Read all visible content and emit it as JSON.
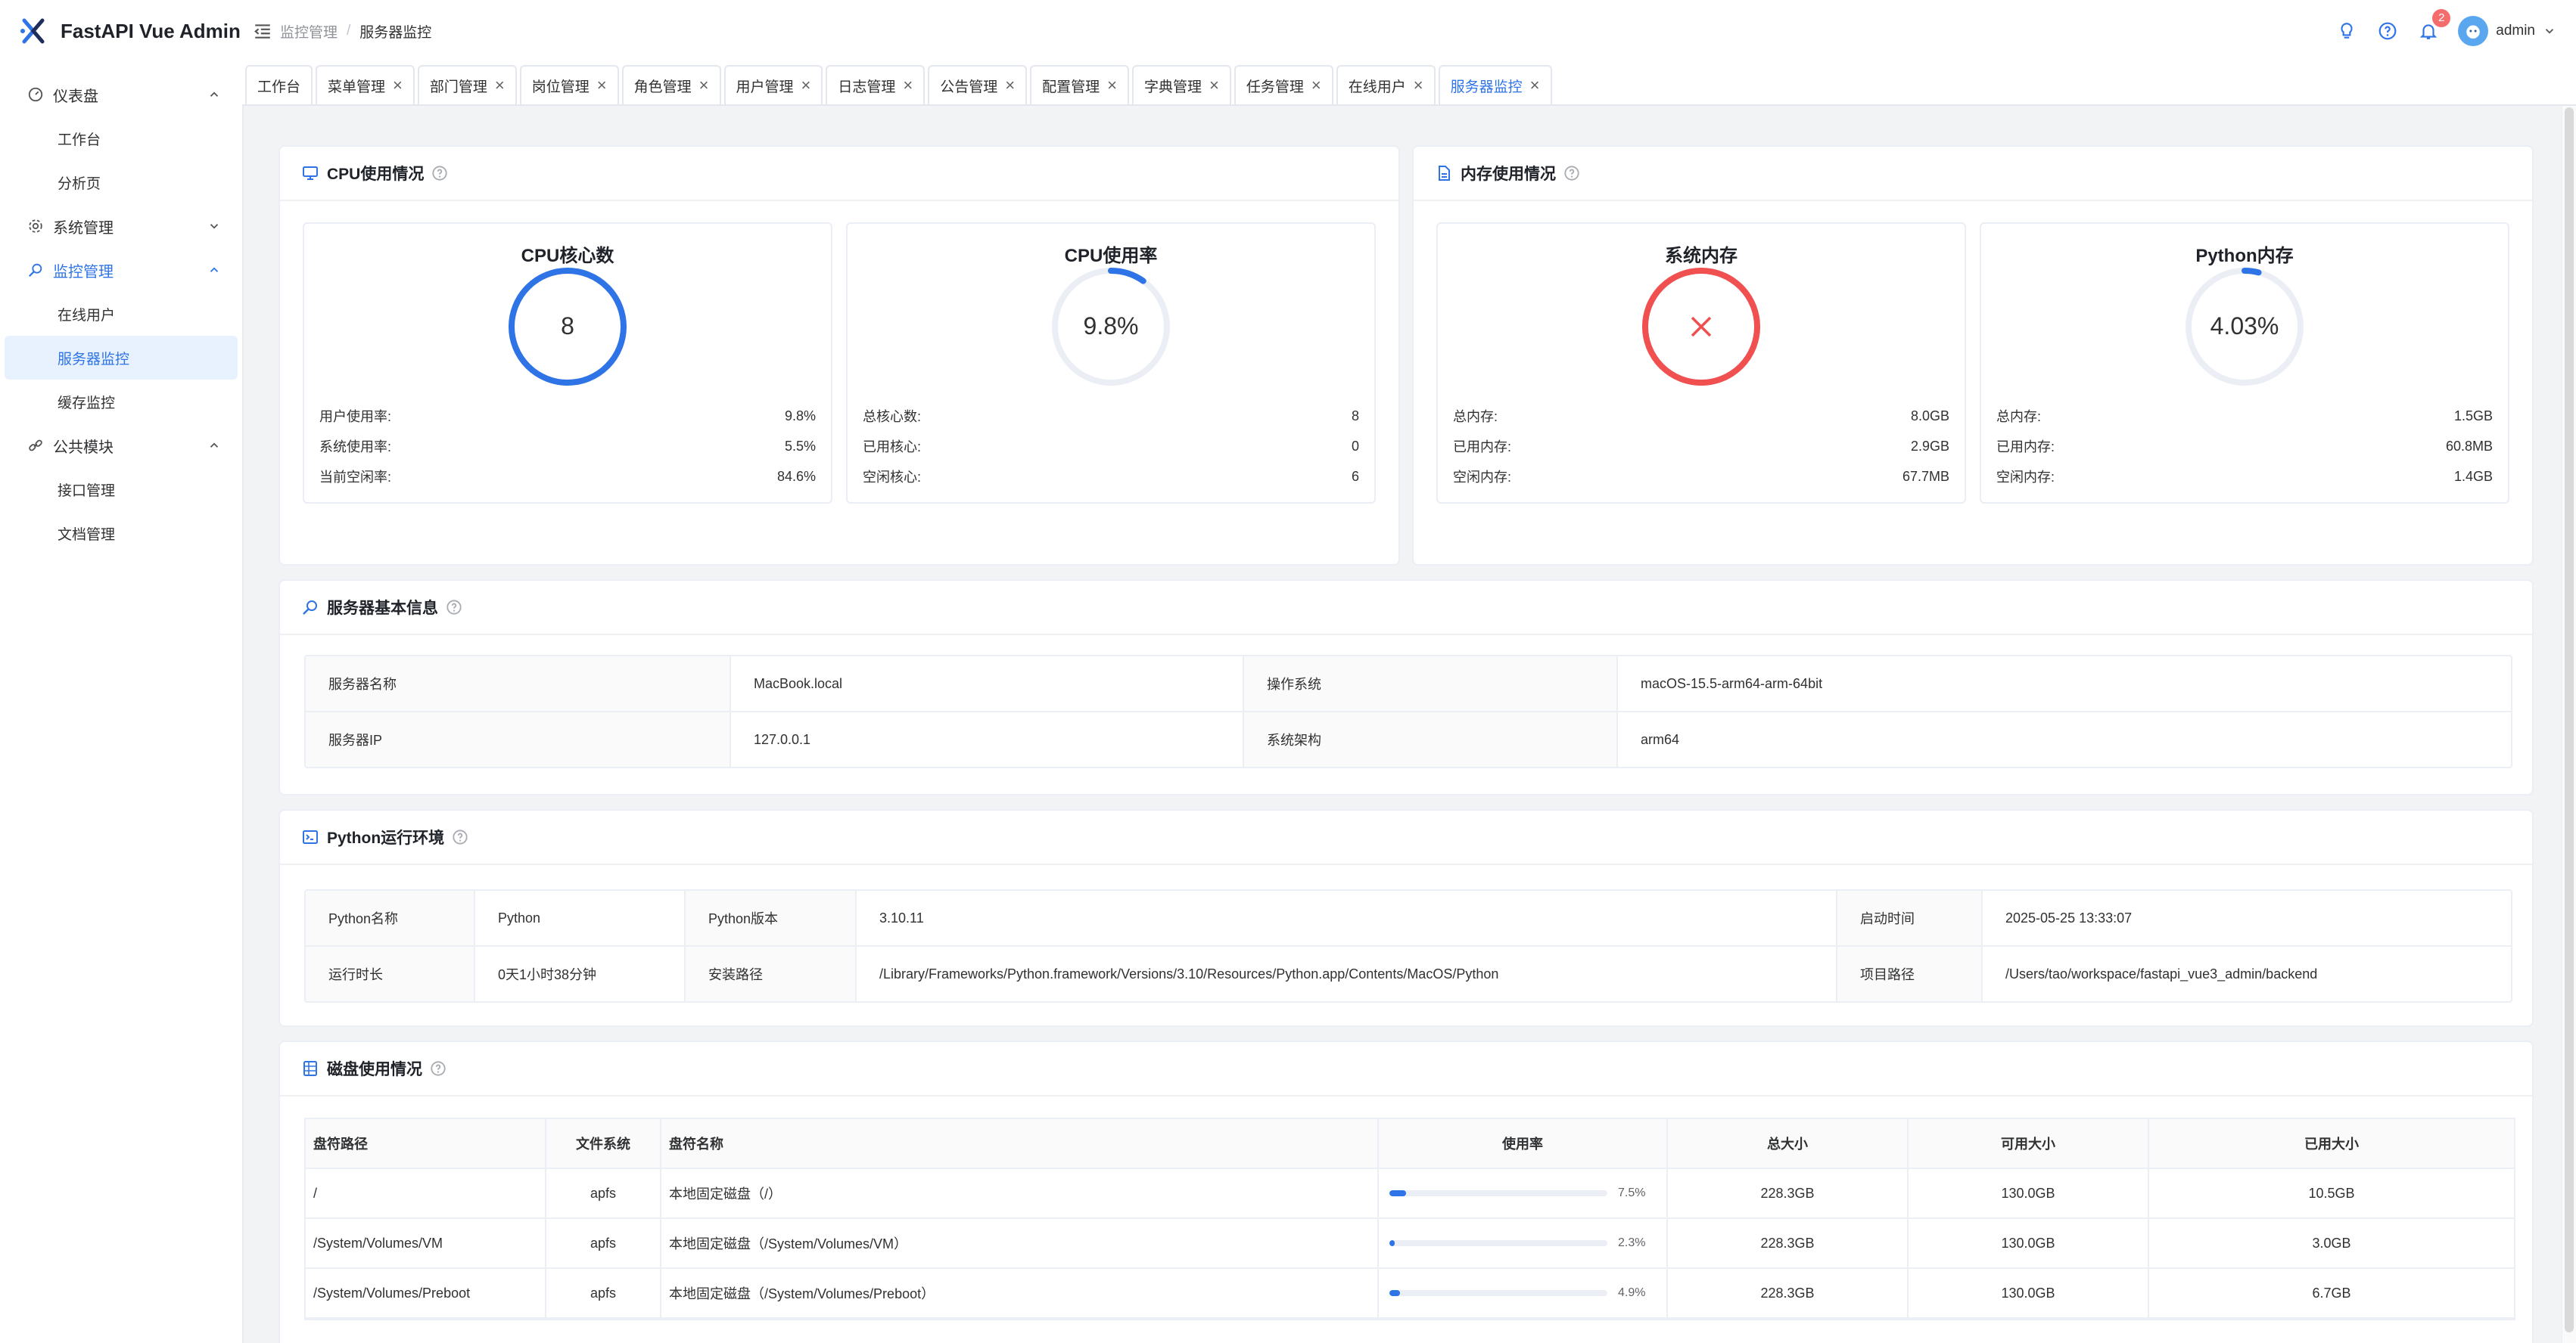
{
  "app": {
    "title": "FastAPI Vue Admin"
  },
  "sidebar": {
    "groups": [
      {
        "label": "仪表盘",
        "icon": "dashboard-icon",
        "expanded": true,
        "items": [
          {
            "label": "工作台"
          },
          {
            "label": "分析页"
          }
        ]
      },
      {
        "label": "系统管理",
        "icon": "gear-icon",
        "expanded": false,
        "items": []
      },
      {
        "label": "监控管理",
        "icon": "monitor-search-icon",
        "expanded": true,
        "active": true,
        "items": [
          {
            "label": "在线用户"
          },
          {
            "label": "服务器监控",
            "active": true
          },
          {
            "label": "缓存监控"
          }
        ]
      },
      {
        "label": "公共模块",
        "icon": "link-icon",
        "expanded": true,
        "items": [
          {
            "label": "接口管理"
          },
          {
            "label": "文档管理"
          }
        ]
      }
    ]
  },
  "header": {
    "breadcrumb": [
      "监控管理",
      "服务器监控"
    ],
    "notification_count": "2",
    "username": "admin"
  },
  "tabs": [
    {
      "label": "工作台",
      "closable": false
    },
    {
      "label": "菜单管理",
      "closable": true
    },
    {
      "label": "部门管理",
      "closable": true
    },
    {
      "label": "岗位管理",
      "closable": true
    },
    {
      "label": "角色管理",
      "closable": true
    },
    {
      "label": "用户管理",
      "closable": true
    },
    {
      "label": "日志管理",
      "closable": true
    },
    {
      "label": "公告管理",
      "closable": true
    },
    {
      "label": "配置管理",
      "closable": true
    },
    {
      "label": "字典管理",
      "closable": true
    },
    {
      "label": "任务管理",
      "closable": true
    },
    {
      "label": "在线用户",
      "closable": true
    },
    {
      "label": "服务器监控",
      "closable": true,
      "active": true
    }
  ],
  "cpu": {
    "title": "CPU使用情况",
    "cores_card": {
      "title": "CPU核心数",
      "value": "8",
      "percent": 100,
      "color": "#2f74e6",
      "stats": [
        {
          "label": "用户使用率:",
          "value": "9.8%"
        },
        {
          "label": "系统使用率:",
          "value": "5.5%"
        },
        {
          "label": "当前空闲率:",
          "value": "84.6%"
        }
      ]
    },
    "usage_card": {
      "title": "CPU使用率",
      "value": "9.8%",
      "percent": 9.8,
      "color": "#2f74e6",
      "stats": [
        {
          "label": "总核心数:",
          "value": "8"
        },
        {
          "label": "已用核心:",
          "value": "0"
        },
        {
          "label": "空闲核心:",
          "value": "6"
        }
      ]
    }
  },
  "memory": {
    "title": "内存使用情况",
    "system_card": {
      "title": "系统内存",
      "value": "",
      "percent": 100,
      "status": "exception",
      "color": "#f05050",
      "stats": [
        {
          "label": "总内存:",
          "value": "8.0GB"
        },
        {
          "label": "已用内存:",
          "value": "2.9GB"
        },
        {
          "label": "空闲内存:",
          "value": "67.7MB"
        }
      ]
    },
    "python_card": {
      "title": "Python内存",
      "value": "4.03%",
      "percent": 4.03,
      "color": "#2f74e6",
      "stats": [
        {
          "label": "总内存:",
          "value": "1.5GB"
        },
        {
          "label": "已用内存:",
          "value": "60.8MB"
        },
        {
          "label": "空闲内存:",
          "value": "1.4GB"
        }
      ]
    }
  },
  "server_info": {
    "title": "服务器基本信息",
    "rows": [
      [
        "服务器名称",
        "MacBook.local",
        "操作系统",
        "macOS-15.5-arm64-arm-64bit"
      ],
      [
        "服务器IP",
        "127.0.0.1",
        "系统架构",
        "arm64"
      ]
    ]
  },
  "python_env": {
    "title": "Python运行环境",
    "rows": [
      [
        "Python名称",
        "Python",
        "Python版本",
        "3.10.11",
        "启动时间",
        "2025-05-25 13:33:07"
      ],
      [
        "运行时长",
        "0天1小时38分钟",
        "安装路径",
        "/Library/Frameworks/Python.framework/Versions/3.10/Resources/Python.app/Contents/MacOS/Python",
        "项目路径",
        "/Users/tao/workspace/fastapi_vue3_admin/backend"
      ]
    ]
  },
  "disk": {
    "title": "磁盘使用情况",
    "columns": [
      "盘符路径",
      "文件系统",
      "盘符名称",
      "使用率",
      "总大小",
      "可用大小",
      "已用大小"
    ],
    "rows": [
      {
        "path": "/",
        "fs": "apfs",
        "name": "本地固定磁盘（/）",
        "usage": 7.5,
        "usage_label": "7.5%",
        "total": "228.3GB",
        "free": "130.0GB",
        "used": "10.5GB"
      },
      {
        "path": "/System/Volumes/VM",
        "fs": "apfs",
        "name": "本地固定磁盘（/System/Volumes/VM）",
        "usage": 2.3,
        "usage_label": "2.3%",
        "total": "228.3GB",
        "free": "130.0GB",
        "used": "3.0GB"
      },
      {
        "path": "/System/Volumes/Preboot",
        "fs": "apfs",
        "name": "本地固定磁盘（/System/Volumes/Preboot）",
        "usage": 4.9,
        "usage_label": "4.9%",
        "total": "228.3GB",
        "free": "130.0GB",
        "used": "6.7GB"
      }
    ]
  }
}
